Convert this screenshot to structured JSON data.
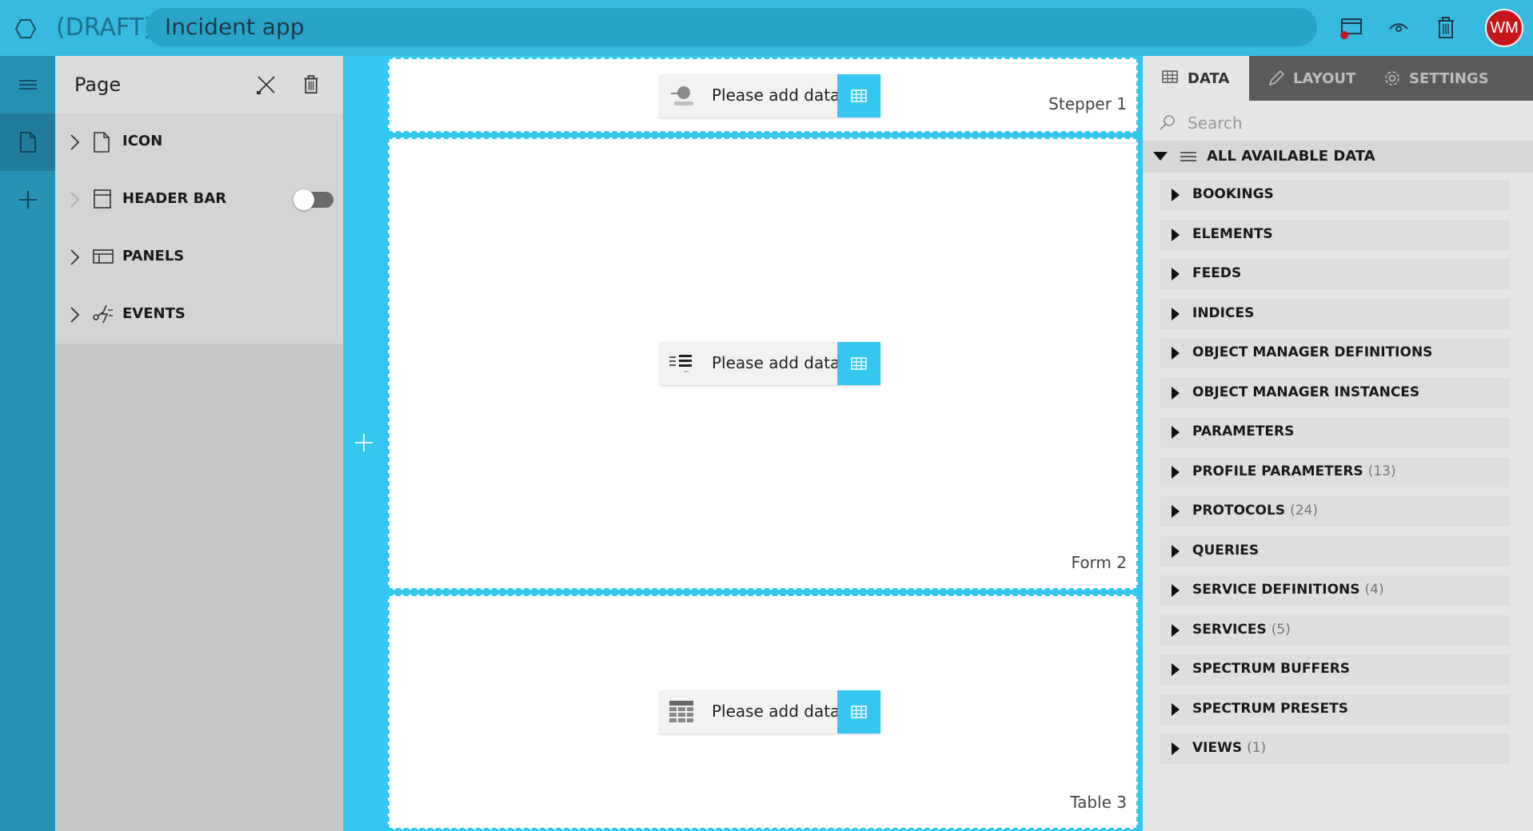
{
  "topbar": {
    "app_icon": "hexagon-icon",
    "draft_label": "(DRAFT)",
    "title": "Incident app",
    "actions": [
      {
        "name": "publish-icon"
      },
      {
        "name": "preview-eye-icon"
      },
      {
        "name": "trash-icon"
      }
    ],
    "avatar_initials": "WM",
    "avatar_color": "#c4161c",
    "accent_color": "#37b9e0"
  },
  "rail": {
    "items": [
      {
        "name": "menu-icon"
      },
      {
        "name": "page-icon",
        "active": true
      },
      {
        "name": "add-icon"
      }
    ]
  },
  "page_panel": {
    "title": "Page",
    "items": [
      {
        "label": "ICON",
        "icon": "file-icon"
      },
      {
        "label": "HEADER BAR",
        "icon": "header-bar-icon",
        "toggle": false
      },
      {
        "label": "PANELS",
        "icon": "panels-icon"
      },
      {
        "label": "EVENTS",
        "icon": "events-icon"
      }
    ]
  },
  "canvas": {
    "panels": [
      {
        "name": "Stepper 1",
        "placeholder": "Please add data",
        "icon": "stepper-icon"
      },
      {
        "name": "Form 2",
        "placeholder": "Please add data",
        "icon": "form-icon"
      },
      {
        "name": "Table 3",
        "placeholder": "Please add data",
        "icon": "table-icon"
      }
    ]
  },
  "right_panel": {
    "tabs": [
      {
        "label": "DATA",
        "icon": "table-icon",
        "active": true
      },
      {
        "label": "LAYOUT",
        "icon": "pencil-icon"
      },
      {
        "label": "SETTINGS",
        "icon": "gear-icon"
      }
    ],
    "search_placeholder": "Search",
    "root_label": "ALL AVAILABLE DATA",
    "items": [
      {
        "label": "BOOKINGS",
        "count": ""
      },
      {
        "label": "ELEMENTS",
        "count": ""
      },
      {
        "label": "FEEDS",
        "count": ""
      },
      {
        "label": "INDICES",
        "count": ""
      },
      {
        "label": "OBJECT MANAGER DEFINITIONS",
        "count": ""
      },
      {
        "label": "OBJECT MANAGER INSTANCES",
        "count": ""
      },
      {
        "label": "PARAMETERS",
        "count": ""
      },
      {
        "label": "PROFILE PARAMETERS",
        "count": "(13)"
      },
      {
        "label": "PROTOCOLS",
        "count": "(24)"
      },
      {
        "label": "QUERIES",
        "count": ""
      },
      {
        "label": "SERVICE DEFINITIONS",
        "count": "(4)"
      },
      {
        "label": "SERVICES",
        "count": "(5)"
      },
      {
        "label": "SPECTRUM BUFFERS",
        "count": ""
      },
      {
        "label": "SPECTRUM PRESETS",
        "count": ""
      },
      {
        "label": "VIEWS",
        "count": "(1)"
      }
    ]
  }
}
